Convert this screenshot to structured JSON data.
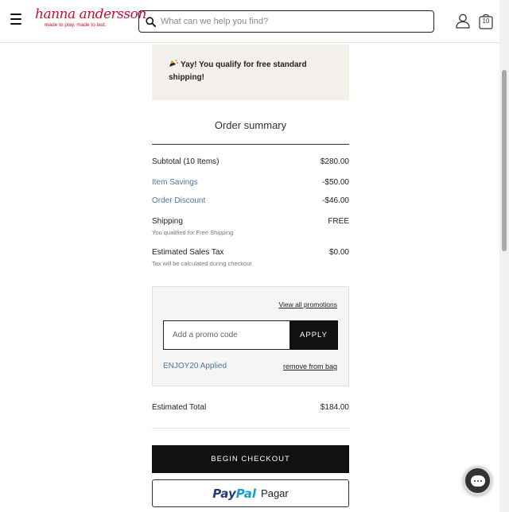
{
  "header": {
    "logo_text": "hanna andersson",
    "logo_tagline": "made to play. made to last.",
    "search_placeholder": "What can we help you find?",
    "bag_count": "10"
  },
  "banner": {
    "free_shipping_text": "Yay! You qualify for free standard shipping!"
  },
  "summary": {
    "title": "Order summary",
    "subtotal_label": "Subtotal (10 Items)",
    "subtotal_value": "$280.00",
    "item_savings_label": "Item Savings",
    "item_savings_value": "-$50.00",
    "order_discount_label": "Order Discount",
    "order_discount_value": "-$46.00",
    "shipping_label": "Shipping",
    "shipping_value": "FREE",
    "shipping_note": "You qualified for Free Shipping",
    "tax_label": "Estimated Sales Tax",
    "tax_value": "$0.00",
    "tax_note": "Tax will be calculated during checkout",
    "total_label": "Estimated Total",
    "total_value": "$184.00"
  },
  "promo": {
    "view_all_label": "View all promotions",
    "input_placeholder": "Add a promo code",
    "apply_label": "APPLY",
    "applied_code_text": "ENJOY20 Applied",
    "remove_label": "remove from bag"
  },
  "actions": {
    "checkout_label": "BEGIN CHECKOUT",
    "paypal_pay": "Pay",
    "paypal_pal": "Pal",
    "paypal_pagar": "Pagar"
  },
  "colors": {
    "brand_red": "#c8102e",
    "link_blue": "#4a78a6",
    "banner_bg": "#f3efeb",
    "button_black": "#111111"
  }
}
